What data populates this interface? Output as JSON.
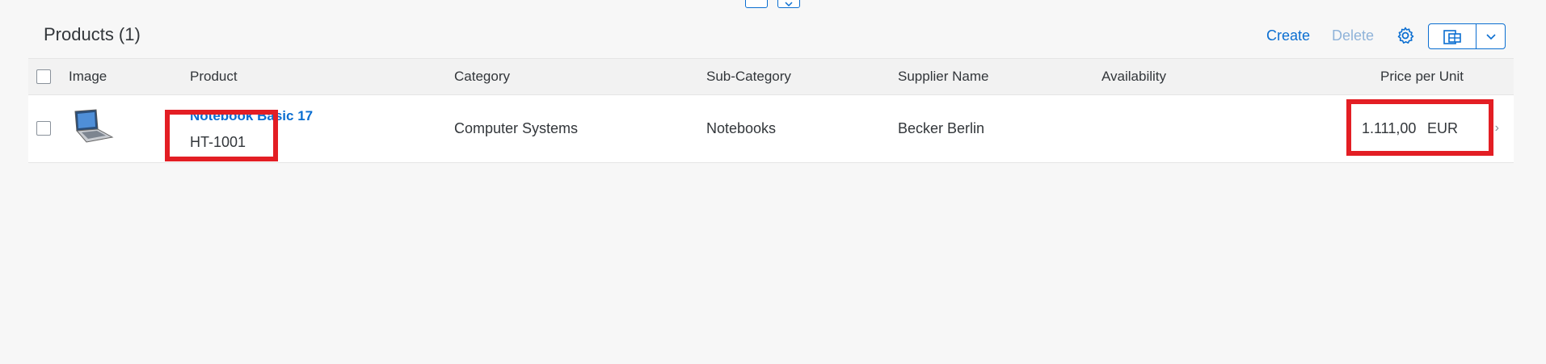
{
  "toolbar": {
    "title": "Products (1)",
    "create_label": "Create",
    "delete_label": "Delete",
    "settings_icon": "gear-icon",
    "export_icon": "spreadsheet-icon",
    "dropdown_icon": "chevron-down-icon"
  },
  "table": {
    "columns": [
      "Image",
      "Product",
      "Category",
      "Sub-Category",
      "Supplier Name",
      "Availability",
      "Price per Unit"
    ],
    "rows": [
      {
        "image": "laptop-image",
        "product_name": "Notebook Basic 17",
        "product_id": "HT-1001",
        "category": "Computer Systems",
        "sub_category": "Notebooks",
        "supplier": "Becker Berlin",
        "availability": "",
        "price": "1.111,00",
        "currency": "EUR"
      }
    ]
  },
  "colors": {
    "accent": "#0a6ed1",
    "highlight": "#e31e24",
    "background": "#f7f7f7"
  }
}
